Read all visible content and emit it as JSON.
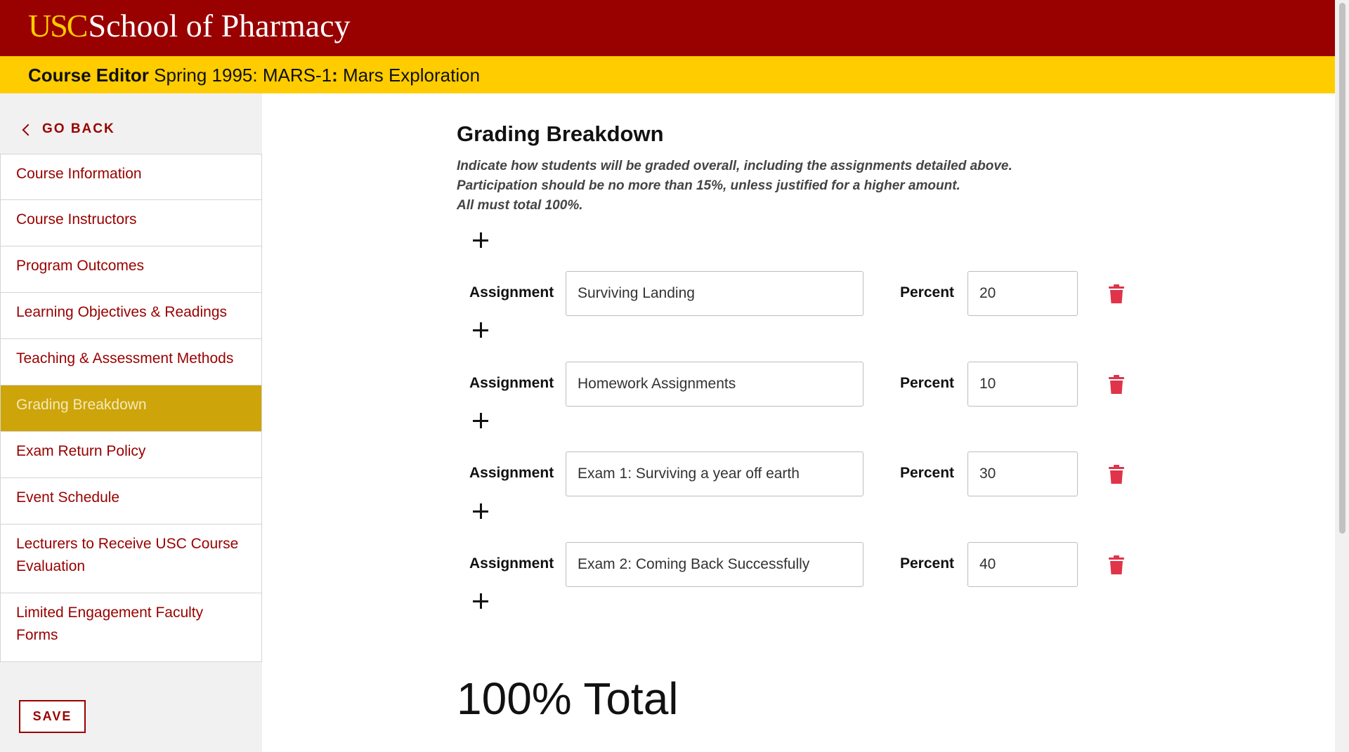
{
  "header": {
    "logo_usc": "USC",
    "logo_school": "School of Pharmacy",
    "subtitle_strong": "Course Editor",
    "subtitle_course": "Spring 1995: MARS-1",
    "subtitle_sep": ":",
    "subtitle_name": "Mars Exploration"
  },
  "sidebar": {
    "go_back": "GO BACK",
    "items": [
      {
        "label": "Course Information"
      },
      {
        "label": "Course Instructors"
      },
      {
        "label": "Program Outcomes"
      },
      {
        "label": "Learning Objectives & Readings"
      },
      {
        "label": "Teaching & Assessment Methods"
      },
      {
        "label": "Grading Breakdown",
        "active": true
      },
      {
        "label": "Exam Return Policy"
      },
      {
        "label": "Event Schedule"
      },
      {
        "label": "Lecturers to Receive USC Course Evaluation"
      },
      {
        "label": "Limited Engagement Faculty Forms"
      }
    ],
    "save": "SAVE"
  },
  "main": {
    "title": "Grading Breakdown",
    "instructions": [
      "Indicate how students will be graded overall, including the assignments detailed above.",
      "Participation should be no more than 15%, unless justified for a higher amount.",
      "All must total 100%."
    ],
    "assignment_label": "Assignment",
    "percent_label": "Percent",
    "rows": [
      {
        "assignment": "Surviving Landing",
        "percent": "20"
      },
      {
        "assignment": "Homework Assignments",
        "percent": "10"
      },
      {
        "assignment": "Exam 1: Surviving a year off earth",
        "percent": "30"
      },
      {
        "assignment": "Exam 2: Coming Back Successfully",
        "percent": "40"
      }
    ],
    "total": "100% Total"
  },
  "icons": {
    "back": "chevron-left-icon",
    "add": "plus-icon",
    "delete": "trash-icon"
  },
  "colors": {
    "usc_cardinal": "#990000",
    "usc_gold": "#FFCC00",
    "active_nav": "#CDA40A",
    "delete_icon": "#E0344A"
  }
}
